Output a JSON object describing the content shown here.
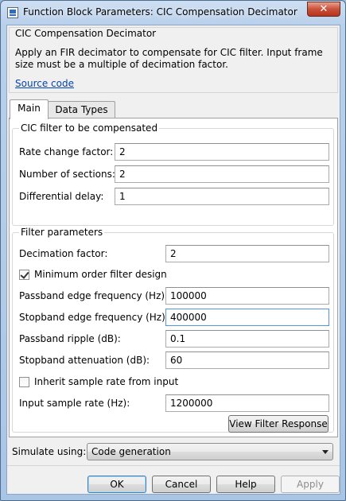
{
  "window": {
    "title": "Function Block Parameters: CIC Compensation Decimator",
    "close_glyph": "✕"
  },
  "header": {
    "block_name": "CIC Compensation Decimator",
    "description": "Apply an FIR decimator to compensate for CIC filter. Input frame size must be a multiple of decimation factor.",
    "source_link": "Source code"
  },
  "tabs": [
    {
      "label": "Main",
      "active": true
    },
    {
      "label": "Data Types",
      "active": false
    }
  ],
  "cic_group": {
    "title": "CIC filter to be compensated",
    "rate_change": {
      "label": "Rate change factor:",
      "value": "2"
    },
    "sections": {
      "label": "Number of sections:",
      "value": "2"
    },
    "diff_delay": {
      "label": "Differential delay:",
      "value": "1"
    }
  },
  "filter_group": {
    "title": "Filter parameters",
    "decimation": {
      "label": "Decimation factor:",
      "value": "2"
    },
    "min_order": {
      "label": "Minimum order filter design",
      "checked": true
    },
    "passband_freq": {
      "label": "Passband edge frequency (Hz):",
      "value": "100000"
    },
    "stopband_freq": {
      "label": "Stopband edge frequency (Hz):",
      "value": "400000"
    },
    "passband_ripple": {
      "label": "Passband ripple (dB):",
      "value": "0.1"
    },
    "stopband_atten": {
      "label": "Stopband attenuation (dB):",
      "value": "60"
    },
    "inherit_rate": {
      "label": "Inherit sample rate from input",
      "checked": false
    },
    "input_rate": {
      "label": "Input sample rate (Hz):",
      "value": "1200000"
    },
    "view_response": "View Filter Response"
  },
  "simulate": {
    "label": "Simulate using:",
    "value": "Code generation"
  },
  "buttons": {
    "ok": "OK",
    "cancel": "Cancel",
    "help": "Help",
    "apply": "Apply"
  }
}
